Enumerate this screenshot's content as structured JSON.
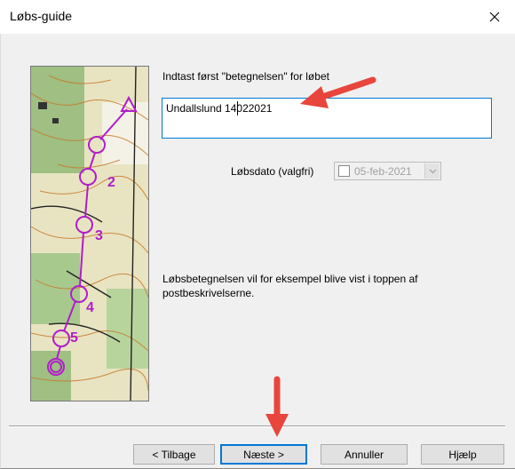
{
  "window": {
    "title": "Løbs-guide",
    "close_icon": "close-icon"
  },
  "main": {
    "instruction": "Indtast først \"betegnelsen\" for løbet",
    "name_input_value": "Undallslund 14022021",
    "date_label": "Løbsdato (valgfri)",
    "date_value": "05-feb-2021",
    "date_checked": false,
    "description": "Løbsbetegnelsen vil for eksempel blive vist i toppen af postbeskrivelserne."
  },
  "buttons": {
    "back": "< Tilbage",
    "next": "Næste >",
    "cancel": "Annuller",
    "help": "Hjælp"
  },
  "annotations": {
    "arrow_color": "#e8453c"
  },
  "colors": {
    "focus_blue": "#0078d7",
    "course_magenta": "#b01ec8"
  }
}
